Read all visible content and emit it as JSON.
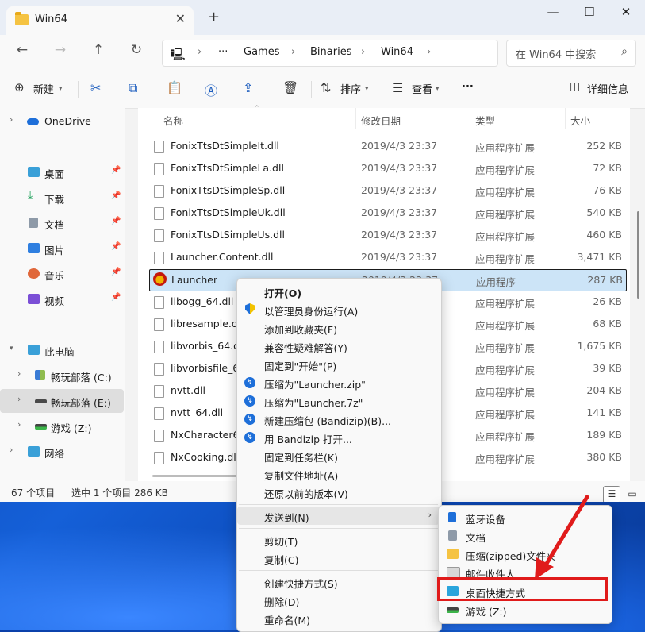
{
  "window": {
    "tab_title": "Win64",
    "close_tab": "✕",
    "new_tab": "+",
    "controls": {
      "minimize": "—",
      "maximize": "☐",
      "close": "✕"
    }
  },
  "address": {
    "more": "···",
    "crumbs": [
      "Games",
      "Binaries",
      "Win64"
    ],
    "search_placeholder": "在 Win64 中搜索"
  },
  "toolbar": {
    "new_label": "新建",
    "sort_label": "排序",
    "view_label": "查看",
    "more": "···",
    "details_label": "详细信息"
  },
  "nav": {
    "items": [
      {
        "label": "OneDrive"
      },
      {
        "label": "桌面"
      },
      {
        "label": "下载"
      },
      {
        "label": "文档"
      },
      {
        "label": "图片"
      },
      {
        "label": "音乐"
      },
      {
        "label": "视频"
      },
      {
        "label": "此电脑"
      },
      {
        "label": "畅玩部落 (C:)"
      },
      {
        "label": "畅玩部落 (E:)"
      },
      {
        "label": "游戏 (Z:)"
      },
      {
        "label": "网络"
      }
    ]
  },
  "columns": {
    "name": "名称",
    "date": "修改日期",
    "type": "类型",
    "size": "大小"
  },
  "files": [
    {
      "name": "FonixTtsDtSimpleIt.dll",
      "date": "2019/4/3 23:37",
      "type": "应用程序扩展",
      "size": "252 KB"
    },
    {
      "name": "FonixTtsDtSimpleLa.dll",
      "date": "2019/4/3 23:37",
      "type": "应用程序扩展",
      "size": "72 KB"
    },
    {
      "name": "FonixTtsDtSimpleSp.dll",
      "date": "2019/4/3 23:37",
      "type": "应用程序扩展",
      "size": "76 KB"
    },
    {
      "name": "FonixTtsDtSimpleUk.dll",
      "date": "2019/4/3 23:37",
      "type": "应用程序扩展",
      "size": "540 KB"
    },
    {
      "name": "FonixTtsDtSimpleUs.dll",
      "date": "2019/4/3 23:37",
      "type": "应用程序扩展",
      "size": "460 KB"
    },
    {
      "name": "Launcher.Content.dll",
      "date": "2019/4/3 23:37",
      "type": "应用程序扩展",
      "size": "3,471 KB"
    },
    {
      "name": "Launcher",
      "date": "2019/4/3 23:37",
      "type": "应用程序",
      "size": "287 KB"
    },
    {
      "name": "libogg_64.dll",
      "date": "",
      "type": "应用程序扩展",
      "size": "26 KB"
    },
    {
      "name": "libresample.dll",
      "date": "",
      "type": "应用程序扩展",
      "size": "68 KB"
    },
    {
      "name": "libvorbis_64.dll",
      "date": "",
      "type": "应用程序扩展",
      "size": "1,675 KB"
    },
    {
      "name": "libvorbisfile_64.dll",
      "date": "",
      "type": "应用程序扩展",
      "size": "39 KB"
    },
    {
      "name": "nvtt.dll",
      "date": "",
      "type": "应用程序扩展",
      "size": "204 KB"
    },
    {
      "name": "nvtt_64.dll",
      "date": "",
      "type": "应用程序扩展",
      "size": "141 KB"
    },
    {
      "name": "NxCharacter64.dll",
      "date": "",
      "type": "应用程序扩展",
      "size": "189 KB"
    },
    {
      "name": "NxCooking.dll",
      "date": "",
      "type": "应用程序扩展",
      "size": "380 KB"
    }
  ],
  "status": {
    "count": "67 个项目",
    "selected": "选中 1 个项目  286 KB"
  },
  "context_menu": {
    "items": [
      "打开(O)",
      "以管理员身份运行(A)",
      "添加到收藏夹(F)",
      "兼容性疑难解答(Y)",
      "固定到\"开始\"(P)",
      "压缩为\"Launcher.zip\"",
      "压缩为\"Launcher.7z\"",
      "新建压缩包 (Bandizip)(B)...",
      "用 Bandizip 打开...",
      "固定到任务栏(K)",
      "复制文件地址(A)",
      "还原以前的版本(V)",
      "发送到(N)",
      "剪切(T)",
      "复制(C)",
      "创建快捷方式(S)",
      "删除(D)",
      "重命名(M)"
    ]
  },
  "send_to": {
    "items": [
      "蓝牙设备",
      "文档",
      "压缩(zipped)文件夹",
      "邮件收件人",
      "桌面快捷方式",
      "游戏 (Z:)"
    ]
  },
  "colors": {
    "accent": "#1e6fd9",
    "selection": "#cce4f7",
    "annotation_red": "#e01b1b"
  }
}
